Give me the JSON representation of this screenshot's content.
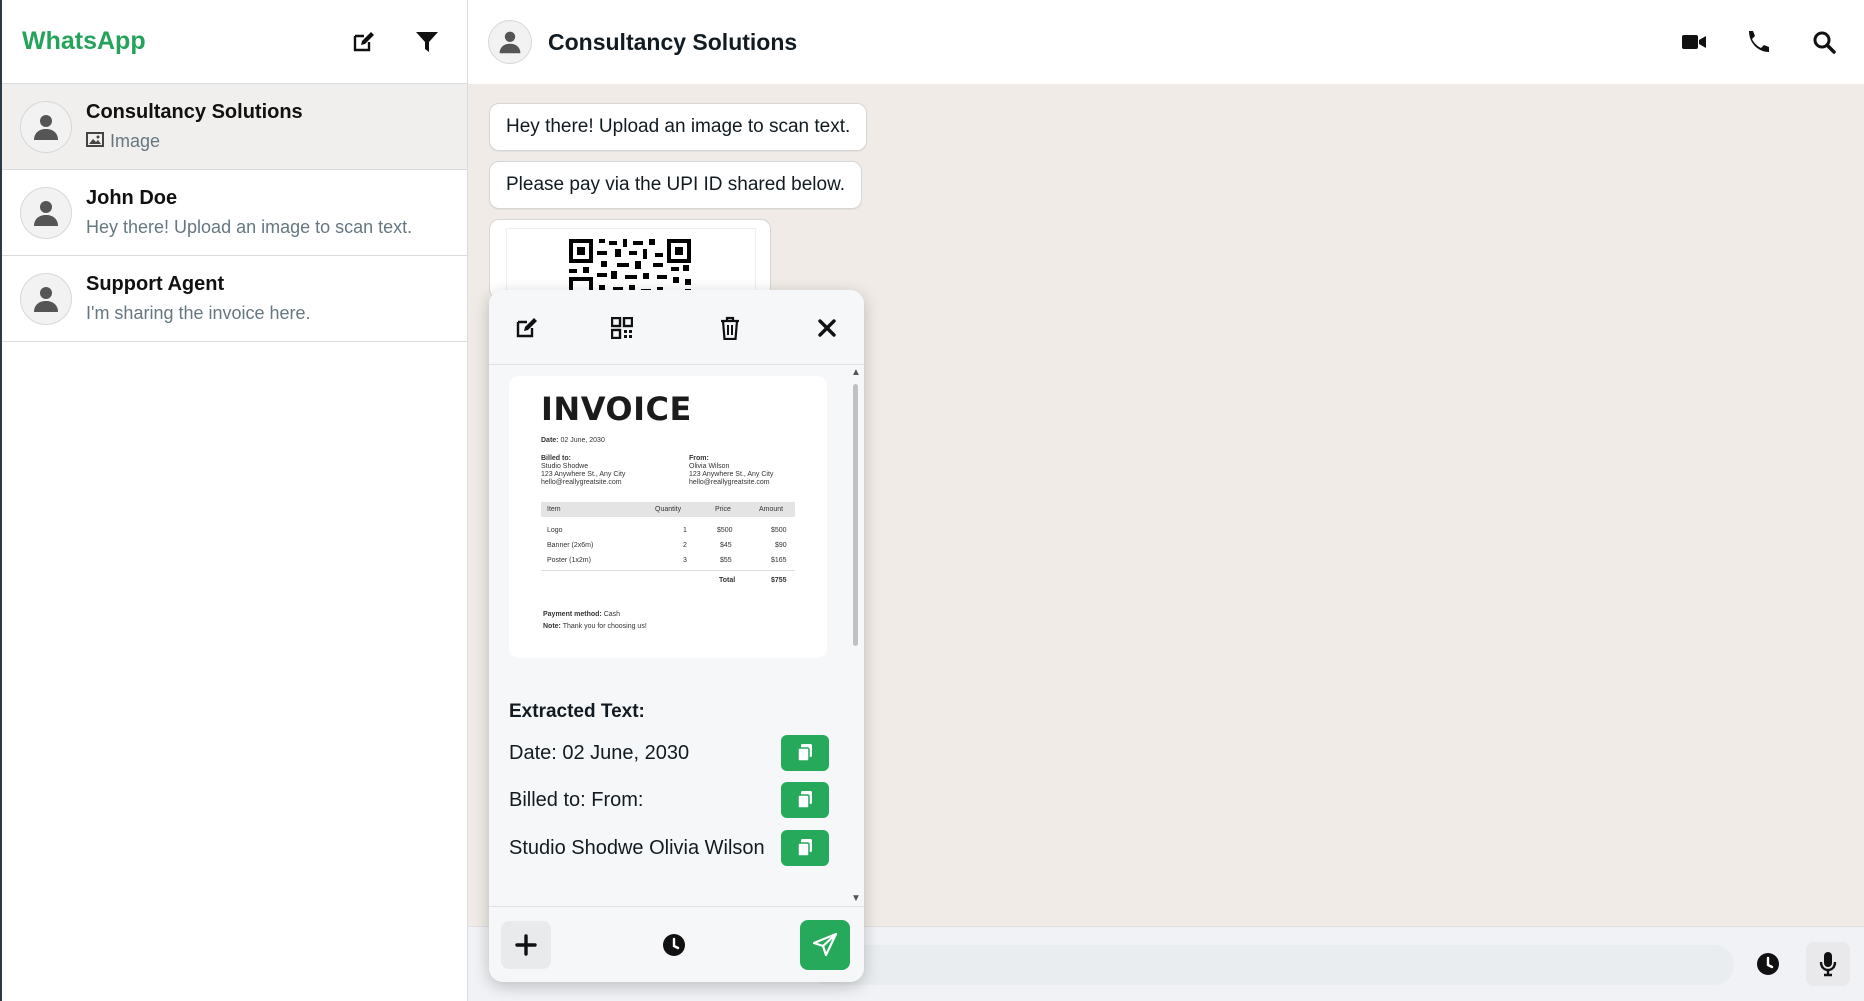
{
  "sidebar": {
    "brand": "WhatsApp",
    "brand_color": "#25a35a",
    "header_icons": [
      "edit-icon",
      "filter-icon"
    ],
    "chats": [
      {
        "name": "Consultancy Solutions",
        "preview": "Image",
        "preview_icon": "image-icon",
        "active": true
      },
      {
        "name": "John Doe",
        "preview": "Hey there! Upload an image to scan text."
      },
      {
        "name": "Support Agent",
        "preview": "I'm sharing the invoice here."
      }
    ]
  },
  "main": {
    "title": "Consultancy Solutions",
    "header_icons": [
      "video-call-icon",
      "phone-icon",
      "search-icon"
    ],
    "messages": [
      "Hey there! Upload an image to scan text.",
      "Please pay via the UPI ID shared below."
    ],
    "composer_icons": [
      "clock-icon",
      "microphone-icon"
    ]
  },
  "popup": {
    "toolbar_icons": [
      "edit-icon",
      "qr-code-icon",
      "trash-icon",
      "close-icon"
    ],
    "invoice": {
      "title": "INVOICE",
      "date_label": "Date:",
      "date_value": "02 June, 2030",
      "billed_to_label": "Billed to:",
      "billed_to_lines": [
        "Studio Shodwe",
        "123 Anywhere St., Any City",
        "hello@reallygreatsite.com"
      ],
      "from_label": "From:",
      "from_lines": [
        "Olivia Wilson",
        "123 Anywhere St., Any City",
        "hello@reallygreatsite.com"
      ],
      "columns": [
        "Item",
        "Quantity",
        "Price",
        "Amount"
      ],
      "rows": [
        [
          "Logo",
          "1",
          "$500",
          "$500"
        ],
        [
          "Banner (2x6m)",
          "2",
          "$45",
          "$90"
        ],
        [
          "Poster (1x2m)",
          "3",
          "$55",
          "$165"
        ]
      ],
      "total_label": "Total",
      "total_value": "$755",
      "payment_label": "Payment method:",
      "payment_value": "Cash",
      "note_label": "Note:",
      "note_value": "Thank you for choosing us!"
    },
    "extracted_title": "Extracted Text:",
    "extracted_lines": [
      "Date: 02 June, 2030",
      "Billed to: From:",
      "Studio Shodwe Olivia Wilson"
    ],
    "footer_icons": [
      "plus-icon",
      "clock-icon",
      "send-icon"
    ],
    "accent_color": "#26a95b"
  }
}
